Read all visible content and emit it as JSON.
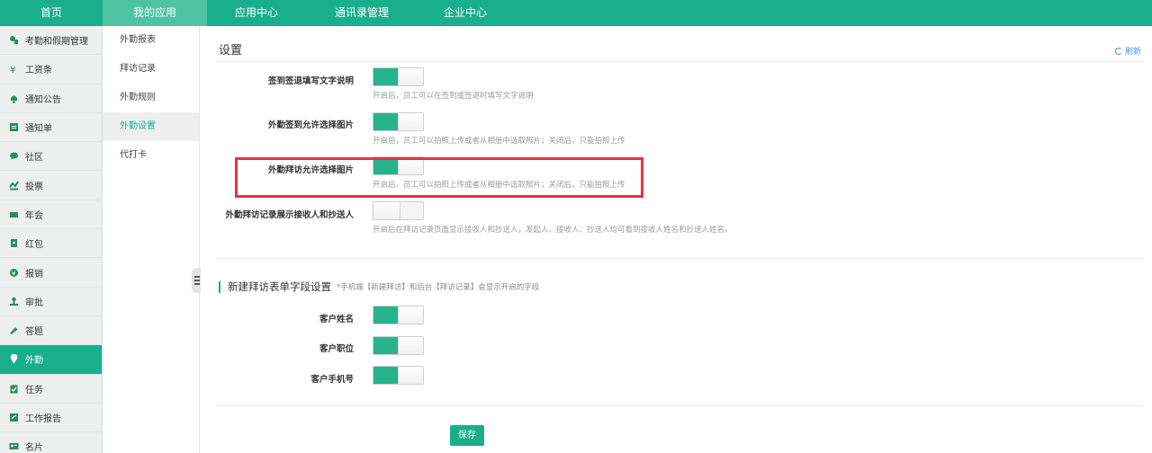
{
  "topnav": [
    {
      "label": "首页"
    },
    {
      "label": "我的应用"
    },
    {
      "label": "应用中心"
    },
    {
      "label": "通讯录管理"
    },
    {
      "label": "企业中心"
    }
  ],
  "sidebar": [
    {
      "label": "考勤和假期管理",
      "icon": "attendance-icon"
    },
    {
      "label": "工资条",
      "icon": "salary-icon"
    },
    {
      "label": "通知公告",
      "icon": "bell-icon"
    },
    {
      "label": "通知单",
      "icon": "notice-icon"
    },
    {
      "label": "社区",
      "icon": "chat-icon"
    },
    {
      "label": "投票",
      "icon": "vote-icon"
    },
    {
      "label": "年会",
      "icon": "ticket-icon"
    },
    {
      "label": "红包",
      "icon": "redpacket-icon"
    },
    {
      "label": "报销",
      "icon": "reimburse-icon"
    },
    {
      "label": "审批",
      "icon": "approval-icon"
    },
    {
      "label": "答题",
      "icon": "quiz-icon"
    },
    {
      "label": "外勤",
      "icon": "location-icon"
    },
    {
      "label": "任务",
      "icon": "task-icon"
    },
    {
      "label": "工作报告",
      "icon": "report-icon"
    },
    {
      "label": "名片",
      "icon": "card-icon"
    }
  ],
  "submenu": [
    {
      "label": "外勤报表"
    },
    {
      "label": "拜访记录"
    },
    {
      "label": "外勤规则"
    },
    {
      "label": "外勤设置"
    },
    {
      "label": "代打卡"
    }
  ],
  "main": {
    "title": "设置",
    "refresh": "刷新",
    "settings": [
      {
        "label": "签到签退填写文字说明",
        "desc": "开启后，员工可以在签到或签退时填写文字说明",
        "on": true
      },
      {
        "label": "外勤签到允许选择图片",
        "desc": "开启后，员工可以拍照上传或者从相册中选取照片；关闭后，只能拍照上传",
        "on": true
      },
      {
        "label": "外勤拜访允许选择图片",
        "desc": "开启后，员工可以拍照上传或者从相册中选取照片；关闭后，只能拍照上传",
        "on": true
      },
      {
        "label": "外勤拜访记录展示接收人和抄送人",
        "desc": "开启后在拜访记录页面显示接收人和抄送人，发起人、接收人、抄送人均可看到接收人姓名和抄送人姓名。",
        "on": false
      }
    ],
    "section": {
      "title": "新建拜访表单字段设置",
      "note": "*手机端【新建拜访】和后台【拜访记录】会显示开启的字段"
    },
    "fields": [
      {
        "label": "客户姓名",
        "on": true
      },
      {
        "label": "客户职位",
        "on": true
      },
      {
        "label": "客户手机号",
        "on": true
      }
    ],
    "save": "保存"
  },
  "colors": {
    "accent": "#1aaf8b",
    "highlight": "#e8323c",
    "link": "#4a90d9"
  }
}
